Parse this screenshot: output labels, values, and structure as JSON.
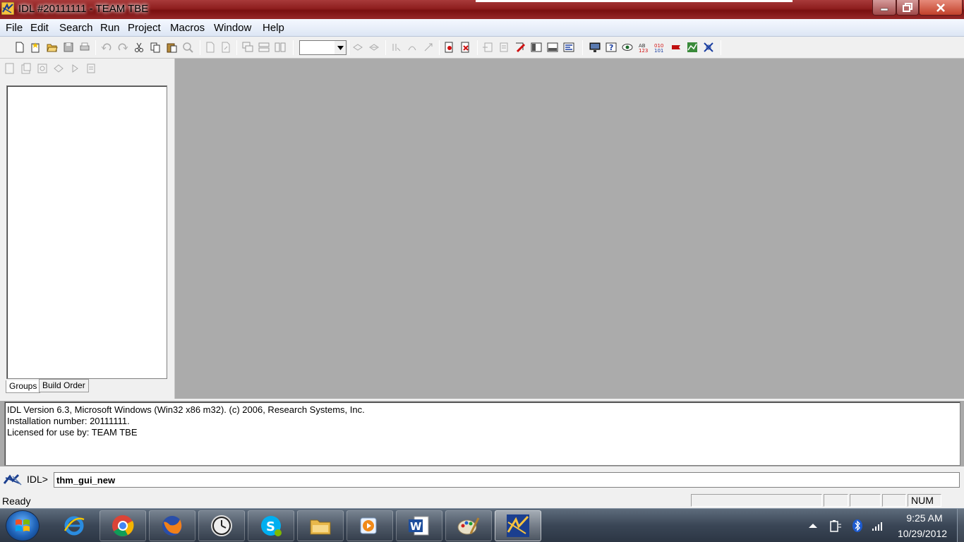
{
  "window": {
    "title": "IDL #20111111 - TEAM TBE"
  },
  "menu": {
    "items": [
      "File",
      "Edit",
      "Search",
      "Run",
      "Project",
      "Macros",
      "Window",
      "Help"
    ]
  },
  "toolbar": {
    "icons": [
      "new-file-icon",
      "new-project-icon",
      "open-icon",
      "save-icon",
      "print-icon",
      "undo-icon",
      "redo-icon",
      "cut-icon",
      "copy-icon",
      "paste-icon",
      "find-icon",
      "indent-icon",
      "outdent-icon",
      "cascade-icon",
      "tile-horizontal-icon",
      "tile-vertical-icon",
      "compile-icon",
      "run-icon",
      "step-into-icon",
      "step-over-icon",
      "step-out-icon",
      "breakpoint-icon",
      "clear-breakpoints-icon",
      "go-to-icon",
      "find-next-icon",
      "edit-icon",
      "left-pane-icon",
      "right-pane-icon",
      "output-icon",
      "display-icon",
      "help-query-icon",
      "watch-icon",
      "variables-icon",
      "binary-icon",
      "flag-icon",
      "graph-icon",
      "stop-icon"
    ],
    "combo_value": ""
  },
  "project_panel": {
    "tabs": [
      "Groups",
      "Build Order"
    ]
  },
  "output": {
    "lines": [
      "IDL Version 6.3, Microsoft Windows (Win32 x86 m32). (c) 2006, Research Systems, Inc.",
      "Installation number: 20111111.",
      "Licensed for use by: TEAM TBE"
    ]
  },
  "command": {
    "prompt": "IDL>",
    "value": "thm_gui_new"
  },
  "status": {
    "text": "Ready",
    "num": "NUM"
  },
  "taskbar": {
    "apps": [
      "internet-explorer-icon",
      "chrome-icon",
      "firefox-icon",
      "clock-icon",
      "skype-icon",
      "file-explorer-icon",
      "media-player-icon",
      "word-icon",
      "paint-icon",
      "idl-icon"
    ],
    "time": "9:25 AM",
    "date": "10/29/2012"
  },
  "colors": {
    "titlebar": "#8e1e1e",
    "editor_bg": "#ababab",
    "taskbar": "#3a4656"
  }
}
